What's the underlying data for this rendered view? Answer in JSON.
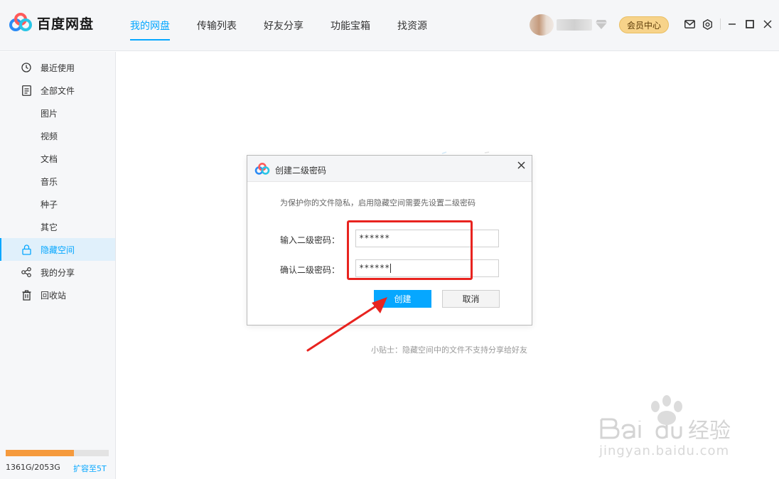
{
  "app": {
    "name": "百度网盘"
  },
  "nav": {
    "tabs": [
      {
        "label": "我的网盘",
        "active": true
      },
      {
        "label": "传输列表"
      },
      {
        "label": "好友分享"
      },
      {
        "label": "功能宝箱"
      },
      {
        "label": "找资源"
      }
    ]
  },
  "header": {
    "vip_label": "会员中心"
  },
  "sidebar": {
    "items": [
      {
        "label": "最近使用",
        "icon": "clock-icon"
      },
      {
        "label": "全部文件",
        "icon": "document-icon"
      },
      {
        "label": "图片"
      },
      {
        "label": "视频"
      },
      {
        "label": "文档"
      },
      {
        "label": "音乐"
      },
      {
        "label": "种子"
      },
      {
        "label": "其它"
      },
      {
        "label": "隐藏空间",
        "icon": "lock-icon",
        "active": true
      },
      {
        "label": "我的分享",
        "icon": "share-icon"
      },
      {
        "label": "回收站",
        "icon": "trash-icon"
      }
    ],
    "storage": {
      "text": "1361G/2053G",
      "used_fraction": 0.663,
      "expand_label": "扩容至5T"
    }
  },
  "main": {
    "tip": "小贴士：隐藏空间中的文件不支持分享给好友"
  },
  "dialog": {
    "title": "创建二级密码",
    "description": "为保护你的文件隐私，启用隐藏空间需要先设置二级密码",
    "password_label": "输入二级密码：",
    "password_value": "******",
    "confirm_label": "确认二级密码：",
    "confirm_value": "******",
    "create_label": "创建",
    "cancel_label": "取消"
  },
  "watermark": {
    "text": "jingyan.baidu.com"
  },
  "colors": {
    "accent": "#06a7ff",
    "vip": "#f7d38a",
    "annotation": "#e8231f",
    "storage": "#f59a3d"
  }
}
